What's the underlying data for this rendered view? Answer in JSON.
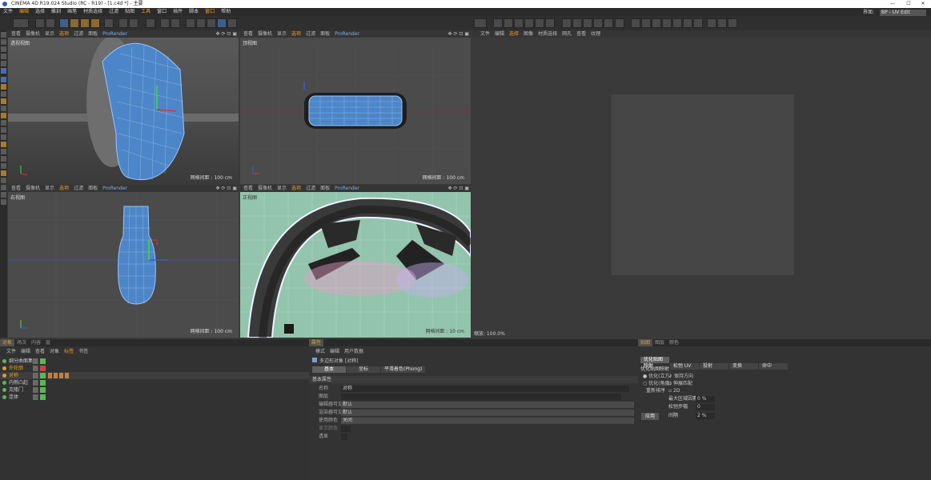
{
  "title": "CINEMA 4D R19.024 Studio (RC - R19) - [1.c4d *] - 主要",
  "window_controls": [
    "—",
    "☐",
    "✕"
  ],
  "menu": [
    "文件",
    "编辑",
    "选择",
    "雕刻",
    "画笔",
    "材质选择",
    "过滤",
    "贴图",
    "工具",
    "窗口",
    "插件",
    "脚本",
    "窗口",
    "帮助"
  ],
  "menu_highlight": [
    1,
    8,
    12
  ],
  "layout_label": "界面:",
  "layout_value": "BP - UV Edit",
  "viewports": [
    {
      "name": "透视视图",
      "grid": "网格间距 : 100 cm",
      "menu": [
        "查看",
        "摄像机",
        "显示",
        "选项",
        "过滤",
        "面板"
      ]
    },
    {
      "name": "顶视图",
      "grid": "网格间距 : 100 cm",
      "menu": [
        "查看",
        "摄像机",
        "显示",
        "选项",
        "过滤",
        "面板",
        "ProRender"
      ]
    },
    {
      "name": "右视图",
      "grid": "网格间距 : 100 cm",
      "menu": [
        "查看",
        "摄像机",
        "显示",
        "选项",
        "过滤",
        "面板",
        "ProRender"
      ]
    },
    {
      "name": "正视图",
      "grid": "网格间距 : 10 cm",
      "menu": [
        "查看",
        "摄像机",
        "显示",
        "选项",
        "过滤",
        "面板",
        "ProRender"
      ]
    }
  ],
  "vp0_extra": "ProRender",
  "vp_ctl": "✥ ⟳ ⊡ ▣",
  "uv_menu": [
    "文件",
    "编辑",
    "选择",
    "图像",
    "材质选择",
    "网孔",
    "查看",
    "纹理"
  ],
  "uv_zoom": "缩放: 100.0%",
  "obj_tabs": [
    "对象",
    "场次",
    "内容",
    "层"
  ],
  "obj_menu": [
    "文件",
    "编辑",
    "查看",
    "对象",
    "标签",
    "书签"
  ],
  "objects": [
    {
      "name": "细分曲面集"
    },
    {
      "name": "外轮廓"
    },
    {
      "name": "对称"
    },
    {
      "name": "内侧凸起"
    },
    {
      "name": "克隆门"
    },
    {
      "name": "连体"
    }
  ],
  "attr_tab": "属性",
  "attr_menu": [
    "模式",
    "编辑",
    "用户数据"
  ],
  "attr_object": "多边形对象 [对称]",
  "attr_tabs": [
    "基本",
    "坐标",
    "平滑着色(Phong)"
  ],
  "attr_section": "基本属性",
  "attr_fields": [
    {
      "label": "名称",
      "value": "对称"
    },
    {
      "label": "图层",
      "value": ""
    },
    {
      "label": "编辑器可见",
      "value": "默认"
    },
    {
      "label": "渲染器可见",
      "value": "默认"
    },
    {
      "label": "使用颜色",
      "value": "关闭"
    },
    {
      "label": "显示颜色",
      "value": ""
    },
    {
      "label": "透显",
      "value": ""
    }
  ],
  "uv_panel_tabs": [
    "贴图",
    "图层",
    "颜色"
  ],
  "uv_buttons": [
    "优化贴图映射",
    "松弛 UV",
    "投射",
    "变换",
    "命中"
  ],
  "uv_section": "优化贴图映射",
  "uv_options": [
    {
      "label": "优化(立方)",
      "check": "保持方向"
    },
    {
      "label": "优化(角度)",
      "check": "伸展匹配"
    },
    {
      "label": "重新排序",
      "check": "2D"
    }
  ],
  "uv_spin": [
    {
      "label": "最大区域因素",
      "value": "0 %"
    },
    {
      "label": "松弛步幅",
      "value": "0"
    },
    {
      "label": "间隔",
      "value": "2 %"
    }
  ],
  "apply_label": "应用",
  "colors": {
    "accent": "#f0a020",
    "mesh": "#5a9be8",
    "uv_bg": "#8fbfaa"
  }
}
